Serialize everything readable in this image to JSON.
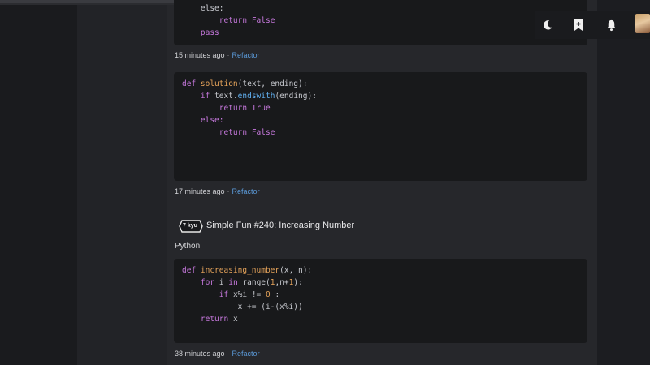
{
  "blocks": [
    {
      "lines": [
        {
          "indent": "    ",
          "tokens": [
            {
              "t": "else:",
              "c": ""
            }
          ]
        },
        {
          "indent": "        ",
          "tokens": [
            {
              "t": "return ",
              "c": "kw"
            },
            {
              "t": "False",
              "c": "lit"
            }
          ]
        },
        {
          "indent": "    ",
          "tokens": [
            {
              "t": "pass",
              "c": "kw"
            }
          ]
        }
      ],
      "time": "15 minutes ago",
      "action": "Refactor"
    },
    {
      "lines": [
        {
          "indent": "",
          "tokens": [
            {
              "t": "def ",
              "c": "kw"
            },
            {
              "t": "solution",
              "c": "fn"
            },
            {
              "t": "(text, ending):",
              "c": ""
            }
          ]
        },
        {
          "indent": "    ",
          "tokens": [
            {
              "t": "if ",
              "c": "kw"
            },
            {
              "t": "text.",
              "c": ""
            },
            {
              "t": "endswith",
              "c": "method"
            },
            {
              "t": "(ending):",
              "c": ""
            }
          ]
        },
        {
          "indent": "        ",
          "tokens": [
            {
              "t": "return ",
              "c": "kw"
            },
            {
              "t": "True",
              "c": "lit"
            }
          ]
        },
        {
          "indent": "    ",
          "tokens": [
            {
              "t": "else:",
              "c": "kw"
            }
          ]
        },
        {
          "indent": "        ",
          "tokens": [
            {
              "t": "return ",
              "c": "kw"
            },
            {
              "t": "False",
              "c": "lit"
            }
          ]
        }
      ],
      "time": "17 minutes ago",
      "action": "Refactor"
    },
    {
      "lines": [
        {
          "indent": "",
          "tokens": [
            {
              "t": "def ",
              "c": "kw"
            },
            {
              "t": "increasing_number",
              "c": "fn"
            },
            {
              "t": "(x, n):",
              "c": ""
            }
          ]
        },
        {
          "indent": "    ",
          "tokens": [
            {
              "t": "for ",
              "c": "kw"
            },
            {
              "t": "i ",
              "c": ""
            },
            {
              "t": "in ",
              "c": "kw"
            },
            {
              "t": "range(",
              "c": ""
            },
            {
              "t": "1",
              "c": "num"
            },
            {
              "t": ",n+",
              "c": ""
            },
            {
              "t": "1",
              "c": "num"
            },
            {
              "t": "):",
              "c": ""
            }
          ]
        },
        {
          "indent": "        ",
          "tokens": [
            {
              "t": "if ",
              "c": "kw"
            },
            {
              "t": "x%i != ",
              "c": ""
            },
            {
              "t": "0",
              "c": "num"
            },
            {
              "t": " :",
              "c": ""
            }
          ]
        },
        {
          "indent": "            ",
          "tokens": [
            {
              "t": "x += (i-(x%i))",
              "c": ""
            }
          ]
        },
        {
          "indent": "    ",
          "tokens": [
            {
              "t": "return ",
              "c": "kw"
            },
            {
              "t": "x",
              "c": ""
            }
          ]
        }
      ],
      "time": "38 minutes ago",
      "action": "Refactor"
    }
  ],
  "kata": {
    "rank": "7 kyu",
    "title": "Simple Fun #240: Increasing Number",
    "language": "Python:"
  },
  "header_icons": [
    "moon-icon",
    "bookmark-icon",
    "bell-icon",
    "avatar"
  ]
}
